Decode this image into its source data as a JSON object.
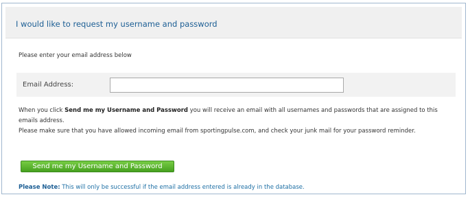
{
  "header": {
    "title": "I would like to request my username and password"
  },
  "form": {
    "intro": "Please enter your email address below",
    "email_label": "Email Address:",
    "email_value": "",
    "email_placeholder": "",
    "info_line1_prefix": "When you click ",
    "info_line1_bold": "Send me my Username and Password",
    "info_line1_suffix": " you will receive an email with all usernames and passwords that are assigned to this emails address.",
    "info_line2": "Please make sure that you have allowed incoming email from sportingpulse.com, and check your junk mail for your password reminder.",
    "submit_label": "Send me my Username and Password",
    "note_label": "Please Note:",
    "note_text": " This will only be successful if the email address entered is already in the database."
  },
  "colors": {
    "header_text": "#1c5e94",
    "note_text": "#1c6ea4",
    "button_green": "#46a11f",
    "panel_border": "#9fb6ce"
  }
}
